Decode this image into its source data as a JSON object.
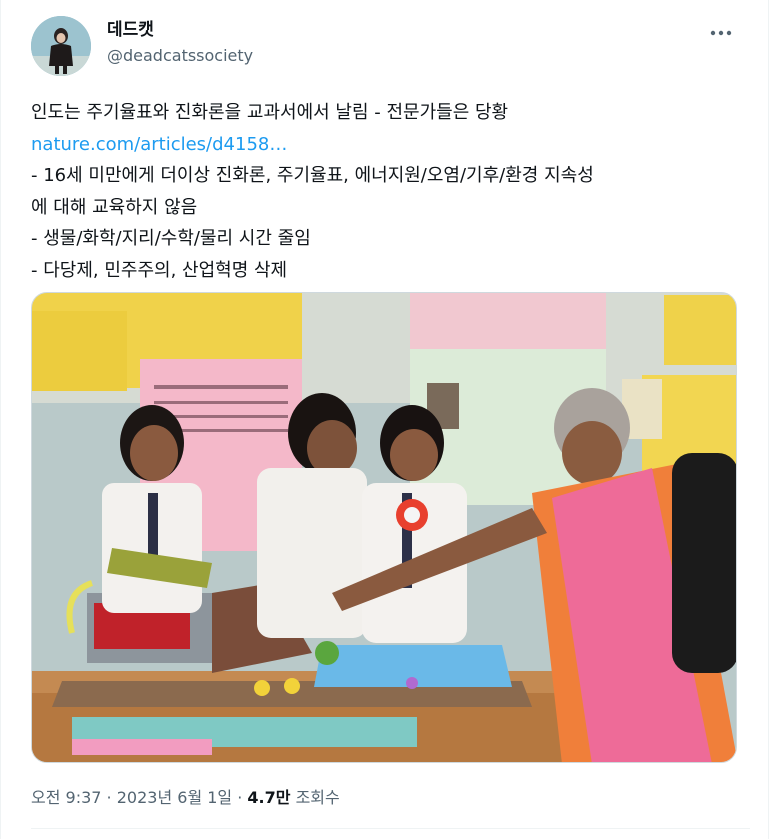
{
  "user": {
    "display_name": "데드캣",
    "handle": "@deadcatssociety"
  },
  "tweet": {
    "lines": [
      "인도는 주기율표와 진화론을 교과서에서 날림 - 전문가들은 당황",
      "nature.com/articles/d4158…",
      "- 16세 미만에게 더이상 진화론, 주기율표, 에너지원/오염/기후/환경 지속성",
      "에 대해 교육하지 않음",
      "- 생물/화학/지리/수학/물리 시간 줄임",
      "- 다당제, 민주주의, 산업혁명 삭제"
    ]
  },
  "meta": {
    "time": "오전 9:37",
    "sep1": " · ",
    "date": "2023년 6월 1일",
    "sep2": " · ",
    "views_count": "4.7만",
    "views_label": " 조회수"
  },
  "icons": {
    "more": "more-horizontal-icon"
  },
  "colors": {
    "link": "#1d9bf0",
    "secondary_text": "#536471",
    "primary_text": "#0f1419"
  }
}
